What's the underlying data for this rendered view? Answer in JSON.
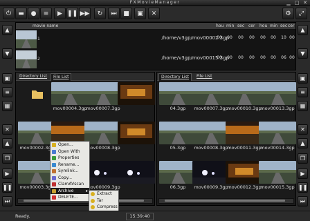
{
  "window": {
    "title": "FXMovieManager"
  },
  "toolbar": {
    "buttons": [
      {
        "name": "power-icon",
        "glyph": "⏻"
      },
      {
        "name": "folder-icon",
        "glyph": "▬"
      },
      {
        "name": "record-icon",
        "glyph": "●"
      },
      {
        "name": "list-icon",
        "glyph": "≡"
      },
      {
        "name": "play-icon",
        "glyph": "▶"
      },
      {
        "name": "pause-icon",
        "glyph": "❚❚"
      },
      {
        "name": "step-icon",
        "glyph": "▶▶"
      },
      {
        "name": "refresh-icon",
        "glyph": "↻"
      },
      {
        "name": "skip-icon",
        "glyph": "⏭"
      },
      {
        "name": "stop-icon",
        "glyph": "■"
      },
      {
        "name": "camera-icon",
        "glyph": "▣"
      },
      {
        "name": "close-icon",
        "glyph": "✕"
      }
    ]
  },
  "grid": {
    "columns": {
      "name": "movie name",
      "h1": "hou",
      "m1": "min",
      "s1": "sec",
      "c1": "cer",
      "h2": "hou",
      "m2": "min",
      "s2": "sec",
      "c2": "cer"
    },
    "rows": [
      {
        "num": "1",
        "path": "/home/v3gp/mov00002.3gp",
        "cells": [
          "00",
          "00",
          "00",
          "00",
          "00",
          "00",
          "10",
          "00"
        ]
      },
      {
        "num": "2",
        "path": "/home/v3gp/mov00015.3gp",
        "cells": [
          "00",
          "00",
          "00",
          "00",
          "00",
          "00",
          "06",
          "00"
        ]
      }
    ]
  },
  "left_panel": {
    "tabs": [
      "Directory List",
      "File List"
    ],
    "files": [
      {
        "name": "",
        "kind": "folder"
      },
      {
        "name": "mov00004.3gp",
        "kind": "road"
      },
      {
        "name": "mov00007.3gp",
        "kind": "road"
      },
      {
        "name": "",
        "kind": "tunnel"
      },
      {
        "name": "mov00002.3gp",
        "kind": "road"
      },
      {
        "name": "mov00005.3gp",
        "kind": "dusk"
      },
      {
        "name": "mov00008.3gp",
        "kind": "road"
      },
      {
        "name": "",
        "kind": "tunnel"
      },
      {
        "name": "mov00003.3gp",
        "kind": "road"
      },
      {
        "name": "mov00006.3gp",
        "kind": "night"
      },
      {
        "name": "mov00009.3gp",
        "kind": "night"
      },
      {
        "name": "",
        "kind": "night"
      }
    ]
  },
  "right_panel": {
    "tabs": [
      "Directory List",
      "File List"
    ],
    "files": [
      {
        "name": "04.3gp",
        "kind": "road"
      },
      {
        "name": "mov00007.3gp",
        "kind": "road"
      },
      {
        "name": "mov00010.3gp",
        "kind": "road"
      },
      {
        "name": "mov00013.3gp",
        "kind": "road"
      },
      {
        "name": "05.3gp",
        "kind": "road"
      },
      {
        "name": "mov00008.3gp",
        "kind": "road"
      },
      {
        "name": "mov00011.3gp",
        "kind": "dusk"
      },
      {
        "name": "mov00014.3gp",
        "kind": "road"
      },
      {
        "name": "06.3gp",
        "kind": "road"
      },
      {
        "name": "mov00009.3gp",
        "kind": "night"
      },
      {
        "name": "mov00012.3gp",
        "kind": "tunnel"
      },
      {
        "name": "mov00015.3gp",
        "kind": "road"
      }
    ]
  },
  "context_menu": {
    "items": [
      {
        "label": "Open...",
        "color": "#d8b020"
      },
      {
        "label": "Open With",
        "color": "#4a7ad0"
      },
      {
        "label": "Properties",
        "color": "#3a9a3a"
      },
      {
        "label": "Rename...",
        "color": "#3a8ad0"
      },
      {
        "label": "Symlink...",
        "color": "#c07030"
      },
      {
        "label": "Copy...",
        "color": "#6a6ad0"
      },
      {
        "label": "ClamAVscan",
        "color": "#c03030"
      },
      {
        "label": "Archive",
        "color": "#c8a030"
      },
      {
        "label": "DELETE...",
        "color": "#d03030"
      }
    ],
    "highlighted": "Archive",
    "submenu": [
      "Extract",
      "Tar",
      "Compress"
    ]
  },
  "status": {
    "text": "Ready.",
    "time": "15:39:40"
  },
  "colors": {
    "bg": "#2a2a2a",
    "panel": "#1b1b1b",
    "menu": "#e8e8e4"
  }
}
